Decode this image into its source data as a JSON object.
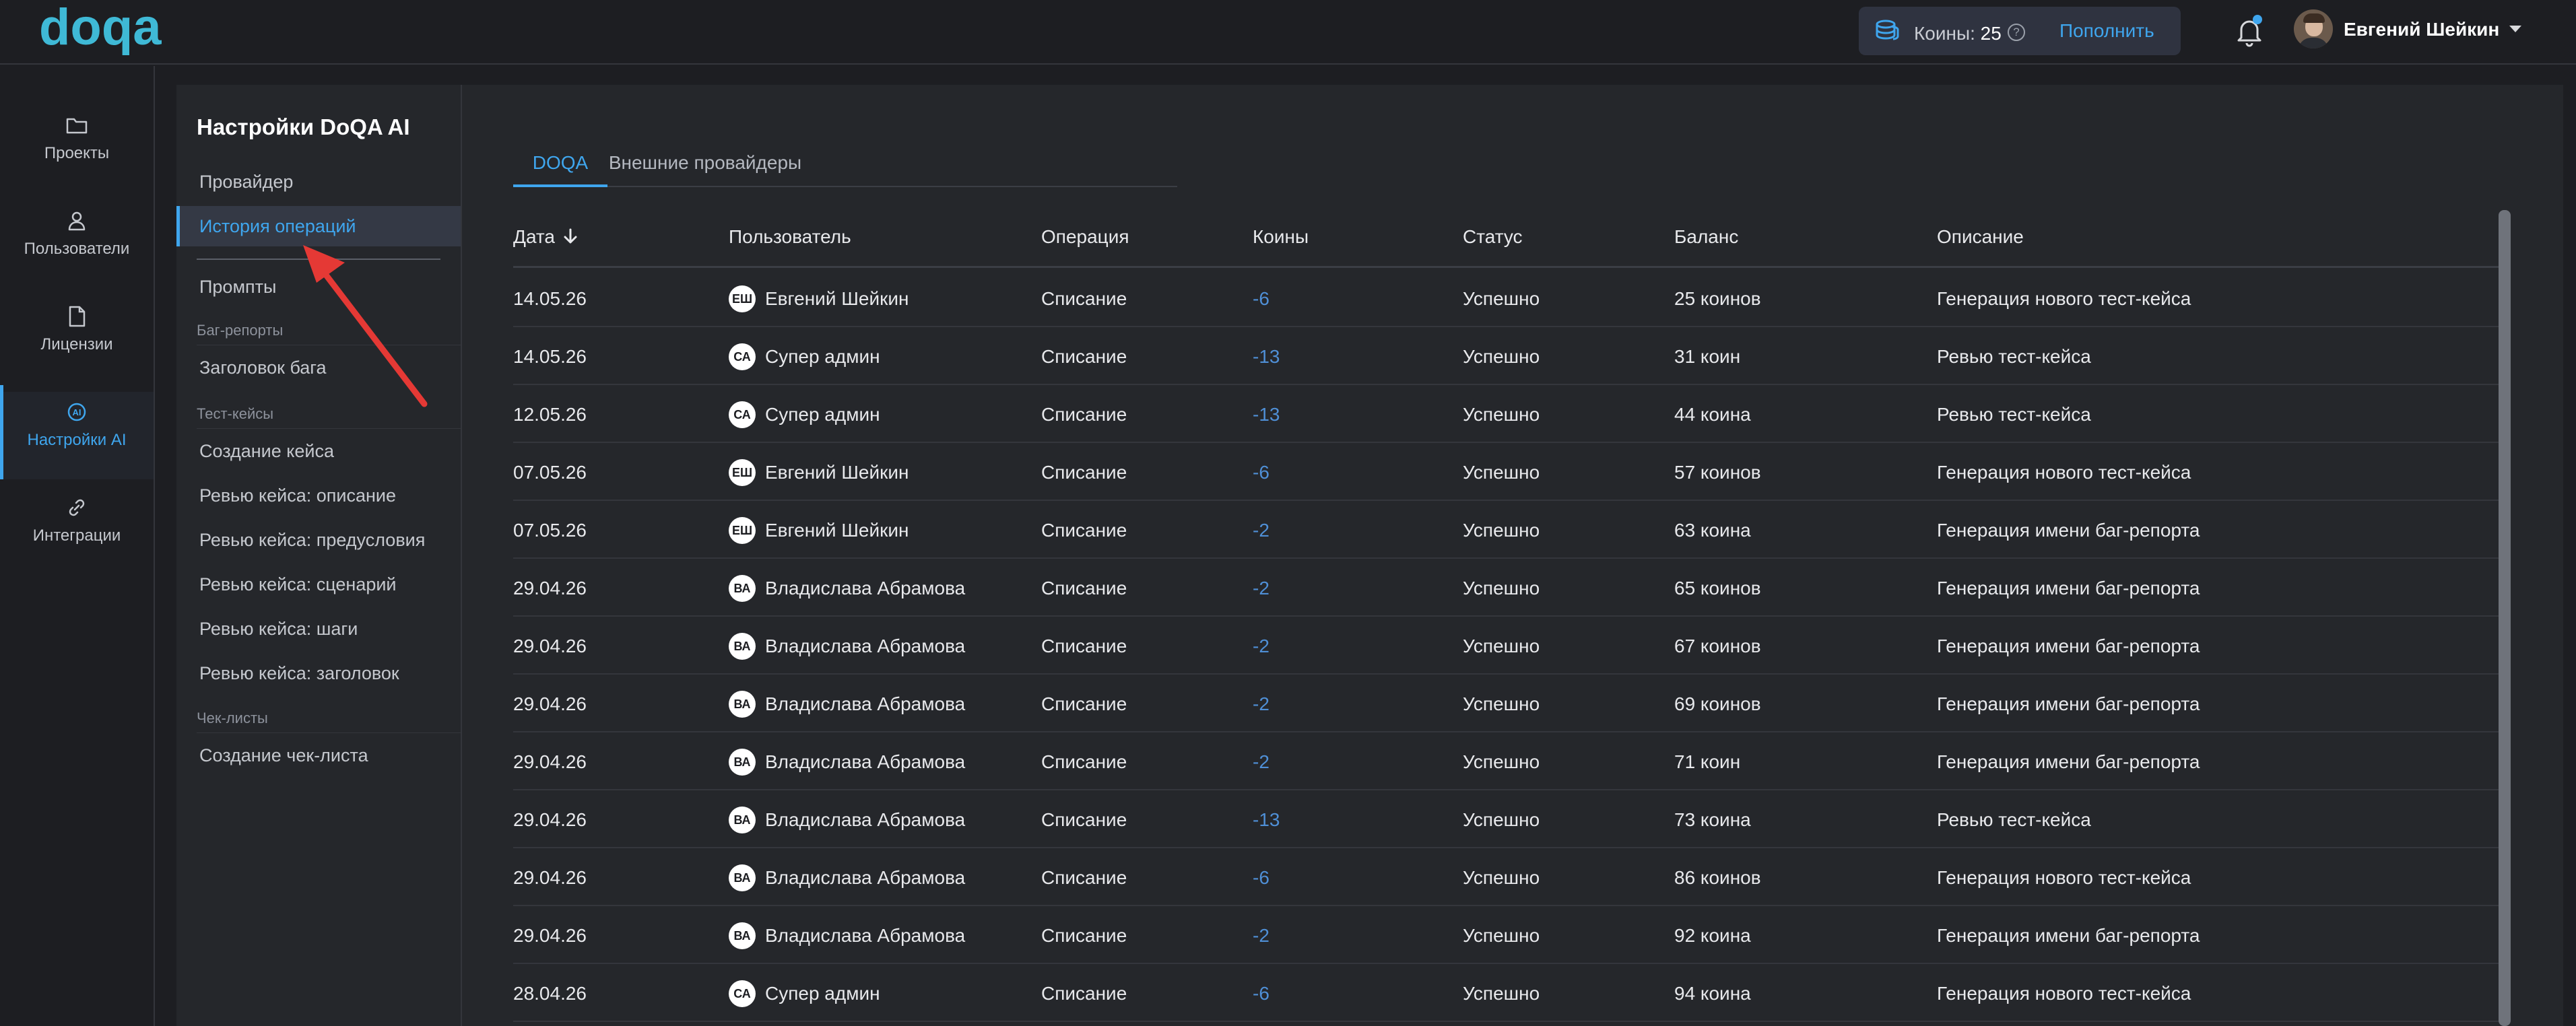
{
  "header": {
    "logo_text": "doqa",
    "coins_label": "Коины:",
    "coins_value": "25",
    "topup_label": "Пополнить",
    "user_name": "Евгений Шейкин",
    "colors": {
      "accent": "#3fa6ee",
      "background": "#1d1e22",
      "panel": "#25272b"
    }
  },
  "rail": {
    "items": [
      {
        "label": "Проекты",
        "icon": "folder-icon"
      },
      {
        "label": "Пользователи",
        "icon": "user-icon"
      },
      {
        "label": "Лицензии",
        "icon": "document-icon"
      },
      {
        "label": "Настройки AI",
        "icon": "ai-settings-icon",
        "active": true
      },
      {
        "label": "Интеграции",
        "icon": "link-icon"
      }
    ]
  },
  "settings": {
    "title": "Настройки DoQA AI",
    "items": [
      {
        "label": "Провайдер"
      },
      {
        "label": "История операций",
        "active": true
      },
      {
        "label": "Промпты"
      },
      {
        "label": "Заголовок бага"
      },
      {
        "label": "Создание кейса"
      },
      {
        "label": "Ревью кейса: описание"
      },
      {
        "label": "Ревью кейса: предусловия"
      },
      {
        "label": "Ревью кейса: сценарий"
      },
      {
        "label": "Ревью кейса: шаги"
      },
      {
        "label": "Ревью кейса: заголовок"
      },
      {
        "label": "Создание чек-листа"
      }
    ],
    "groups": [
      "Баг-репорты",
      "Тест-кейсы",
      "Чек-листы"
    ]
  },
  "tabs": [
    {
      "label": "DOQA",
      "active": true
    },
    {
      "label": "Внешние провайдеры"
    }
  ],
  "table": {
    "columns": [
      "Дата",
      "Пользователь",
      "Операция",
      "Коины",
      "Статус",
      "Баланс",
      "Описание"
    ],
    "sort_column": "Дата",
    "sort_direction": "desc",
    "rows": [
      {
        "date": "14.05.26",
        "initials": "ЕШ",
        "user": "Евгений Шейкин",
        "operation": "Списание",
        "coins": "-6",
        "status": "Успешно",
        "balance": "25 коинов",
        "description": "Генерация нового тест-кейса"
      },
      {
        "date": "14.05.26",
        "initials": "СА",
        "user": "Супер админ",
        "operation": "Списание",
        "coins": "-13",
        "status": "Успешно",
        "balance": "31 коин",
        "description": "Ревью тест-кейса"
      },
      {
        "date": "12.05.26",
        "initials": "СА",
        "user": "Супер админ",
        "operation": "Списание",
        "coins": "-13",
        "status": "Успешно",
        "balance": "44 коина",
        "description": "Ревью тест-кейса"
      },
      {
        "date": "07.05.26",
        "initials": "ЕШ",
        "user": "Евгений Шейкин",
        "operation": "Списание",
        "coins": "-6",
        "status": "Успешно",
        "balance": "57 коинов",
        "description": "Генерация нового тест-кейса"
      },
      {
        "date": "07.05.26",
        "initials": "ЕШ",
        "user": "Евгений Шейкин",
        "operation": "Списание",
        "coins": "-2",
        "status": "Успешно",
        "balance": "63 коина",
        "description": "Генерация имени баг-репорта"
      },
      {
        "date": "29.04.26",
        "initials": "ВА",
        "user": "Владислава Абрамова",
        "operation": "Списание",
        "coins": "-2",
        "status": "Успешно",
        "balance": "65 коинов",
        "description": "Генерация имени баг-репорта"
      },
      {
        "date": "29.04.26",
        "initials": "ВА",
        "user": "Владислава Абрамова",
        "operation": "Списание",
        "coins": "-2",
        "status": "Успешно",
        "balance": "67 коинов",
        "description": "Генерация имени баг-репорта"
      },
      {
        "date": "29.04.26",
        "initials": "ВА",
        "user": "Владислава Абрамова",
        "operation": "Списание",
        "coins": "-2",
        "status": "Успешно",
        "balance": "69 коинов",
        "description": "Генерация имени баг-репорта"
      },
      {
        "date": "29.04.26",
        "initials": "ВА",
        "user": "Владислава Абрамова",
        "operation": "Списание",
        "coins": "-2",
        "status": "Успешно",
        "balance": "71 коин",
        "description": "Генерация имени баг-репорта"
      },
      {
        "date": "29.04.26",
        "initials": "ВА",
        "user": "Владислава Абрамова",
        "operation": "Списание",
        "coins": "-13",
        "status": "Успешно",
        "balance": "73 коина",
        "description": "Ревью тест-кейса"
      },
      {
        "date": "29.04.26",
        "initials": "ВА",
        "user": "Владислава Абрамова",
        "operation": "Списание",
        "coins": "-6",
        "status": "Успешно",
        "balance": "86 коинов",
        "description": "Генерация нового тест-кейса"
      },
      {
        "date": "29.04.26",
        "initials": "ВА",
        "user": "Владислава Абрамова",
        "operation": "Списание",
        "coins": "-2",
        "status": "Успешно",
        "balance": "92 коина",
        "description": "Генерация имени баг-репорта"
      },
      {
        "date": "28.04.26",
        "initials": "СА",
        "user": "Супер админ",
        "operation": "Списание",
        "coins": "-6",
        "status": "Успешно",
        "balance": "94 коина",
        "description": "Генерация нового тест-кейса"
      }
    ]
  }
}
